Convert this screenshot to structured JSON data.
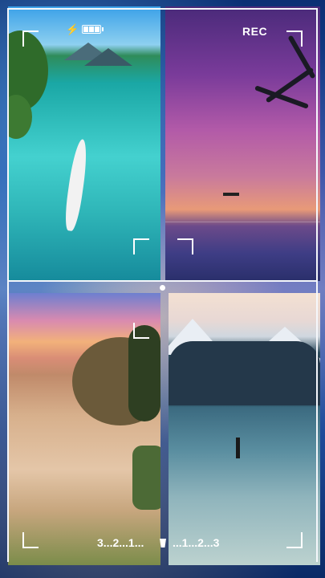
{
  "viewfinder": {
    "rec_label": "REC",
    "flash_icon": "lightning-bolt",
    "battery_icon": "battery-full",
    "battery_level": 1.0
  },
  "tiles": [
    {
      "name": "tropical-lagoon"
    },
    {
      "name": "purple-sunset-swing"
    },
    {
      "name": "coastal-beach-sunset"
    },
    {
      "name": "frozen-lake-mountains"
    }
  ],
  "countdown": {
    "left": "3...2...1...",
    "right": "...1...2...3"
  },
  "colors": {
    "frame": "#f5f7fb",
    "background": "#1d4fa3"
  }
}
